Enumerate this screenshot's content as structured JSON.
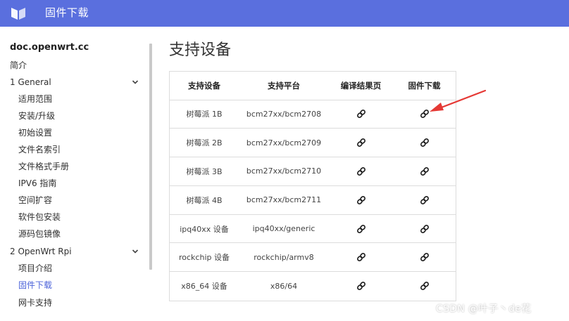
{
  "header": {
    "title": "固件下载",
    "logo_icon": "openwrt-book-icon",
    "bg_color": "#5a6fde"
  },
  "sidebar": {
    "site_name": "doc.openwrt.cc",
    "items": [
      {
        "label": "简介",
        "level": "top"
      },
      {
        "label": "1 General",
        "level": "top",
        "expandable": true
      },
      {
        "label": "适用范围",
        "level": "sub"
      },
      {
        "label": "安装/升级",
        "level": "sub"
      },
      {
        "label": "初始设置",
        "level": "sub"
      },
      {
        "label": "文件名索引",
        "level": "sub"
      },
      {
        "label": "文件格式手册",
        "level": "sub"
      },
      {
        "label": "IPV6 指南",
        "level": "sub"
      },
      {
        "label": "空间扩容",
        "level": "sub"
      },
      {
        "label": "软件包安装",
        "level": "sub"
      },
      {
        "label": "源码包镜像",
        "level": "sub"
      },
      {
        "label": "2 OpenWrt Rpi",
        "level": "top",
        "expandable": true
      },
      {
        "label": "项目介绍",
        "level": "sub"
      },
      {
        "label": "固件下载",
        "level": "sub",
        "active": true
      },
      {
        "label": "网卡支持",
        "level": "sub"
      }
    ],
    "active_color": "#4c63d9"
  },
  "main": {
    "page_title": "支持设备",
    "table": {
      "columns": [
        "支持设备",
        "支持平台",
        "编译结果页",
        "固件下载"
      ],
      "rows": [
        {
          "device": "树莓派 1B",
          "platform": "bcm27xx/bcm2708"
        },
        {
          "device": "树莓派 2B",
          "platform": "bcm27xx/bcm2709"
        },
        {
          "device": "树莓派 3B",
          "platform": "bcm27xx/bcm2710"
        },
        {
          "device": "树莓派 4B",
          "platform": "bcm27xx/bcm2711"
        },
        {
          "device": "ipq40xx 设备",
          "platform": "ipq40xx/generic"
        },
        {
          "device": "rockchip 设备",
          "platform": "rockchip/armv8"
        },
        {
          "device": "x86_64 设备",
          "platform": "x86/64"
        }
      ],
      "link_icon": "link-icon"
    }
  },
  "annotation": {
    "arrow_color": "#e53935"
  },
  "watermark": "CSDN @叶子丶de花"
}
